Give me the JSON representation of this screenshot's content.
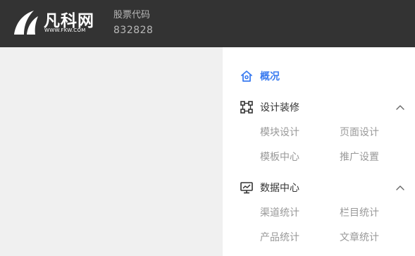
{
  "brand": {
    "name_cn": "凡科网",
    "name_en": "WWW.FKW.COM"
  },
  "stock": {
    "label": "股票代码",
    "code": "832828"
  },
  "menu": {
    "overview": {
      "label": "概况",
      "icon": "home-icon"
    },
    "design": {
      "label": "设计装修",
      "icon": "layout-icon",
      "expanded": true,
      "items": [
        "模块设计",
        "页面设计",
        "模板中心",
        "推广设置"
      ]
    },
    "data": {
      "label": "数据中心",
      "icon": "monitor-chart-icon",
      "expanded": true,
      "items": [
        "渠道统计",
        "栏目统计",
        "产品统计",
        "文章统计"
      ]
    }
  },
  "colors": {
    "topbar": "#333333",
    "accent": "#3a7bf0",
    "subitem": "#999999",
    "background": "#f0f0f0"
  }
}
